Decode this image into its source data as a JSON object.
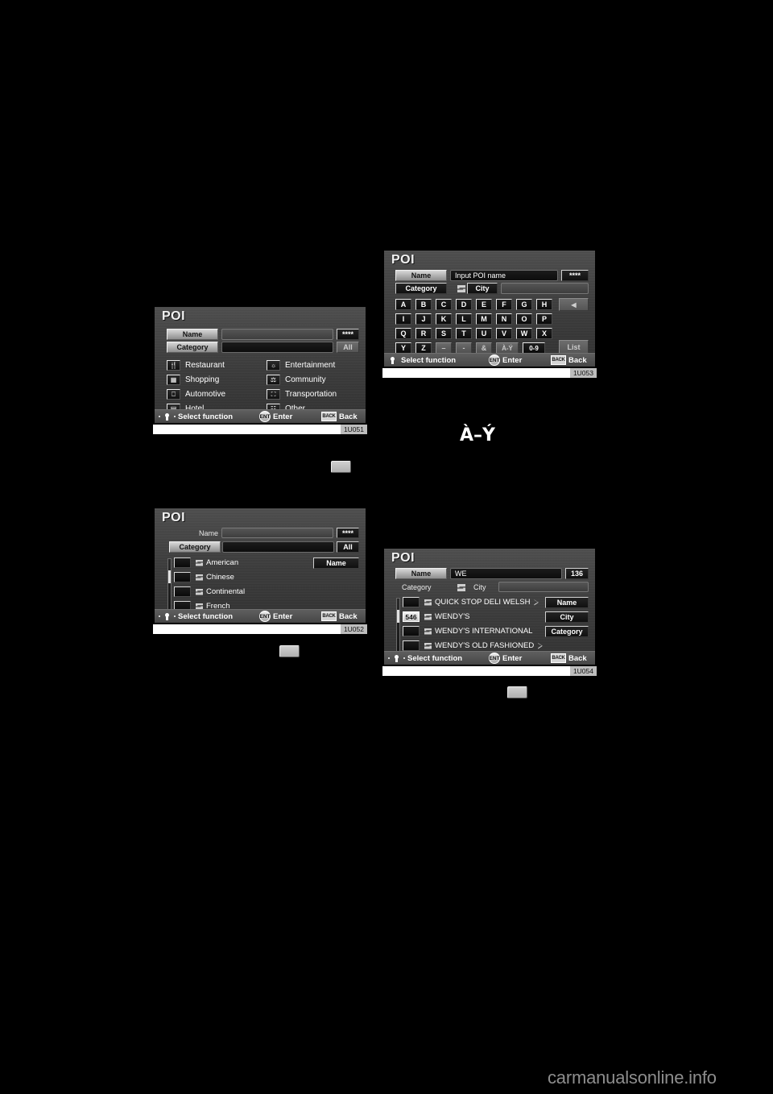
{
  "page": {
    "background": "#000000",
    "footer_text": "carmanualsonline.info"
  },
  "shots": [
    {
      "id": "poi-category-menu",
      "caption": "1U051",
      "title": "POI",
      "name_button": "Name",
      "name_value": "",
      "stars_button": "****",
      "category_button": "Category",
      "category_value": "",
      "all_button": "All",
      "categories": [
        {
          "label": "Restaurant",
          "icon": "restaurant-icon"
        },
        {
          "label": "Shopping",
          "icon": "shopping-icon"
        },
        {
          "label": "Automotive",
          "icon": "automotive-icon"
        },
        {
          "label": "Hotel",
          "icon": "hotel-icon"
        },
        {
          "label": "Entertainment",
          "icon": "entertainment-icon"
        },
        {
          "label": "Community",
          "icon": "community-icon"
        },
        {
          "label": "Transportation",
          "icon": "transportation-icon"
        },
        {
          "label": "Other",
          "icon": "other-icon"
        }
      ],
      "hints": {
        "select": "Select function",
        "enter": "Enter",
        "enter_icon": "ENT",
        "back": "Back",
        "back_icon": "BACK"
      }
    },
    {
      "id": "poi-subcategory-list",
      "caption": "1U052",
      "title": "POI",
      "name_label": "Name",
      "name_value": "",
      "stars_button": "****",
      "category_button": "Category",
      "category_value": "",
      "all_button": "All",
      "side_button": "Name",
      "items": [
        {
          "label": "American",
          "box": "",
          "icon": "list-icon"
        },
        {
          "label": "Chinese",
          "box": "",
          "icon": "list-icon"
        },
        {
          "label": "Continental",
          "box": "",
          "icon": "list-icon"
        },
        {
          "label": "French",
          "box": "",
          "icon": "list-icon"
        }
      ],
      "hints": {
        "select": "Select function",
        "enter": "Enter",
        "enter_icon": "ENT",
        "back": "Back",
        "back_icon": "BACK"
      }
    },
    {
      "id": "poi-name-keyboard",
      "caption": "1U053",
      "title": "POI",
      "name_button": "Name",
      "name_value": "Input POI name",
      "stars_button": "****",
      "category_button": "Category",
      "swap_icon": "swap-icon",
      "city_button": "City",
      "city_value": "",
      "keys_row1": [
        "A",
        "B",
        "C",
        "D",
        "E",
        "F",
        "G",
        "H"
      ],
      "keys_row2": [
        "I",
        "J",
        "K",
        "L",
        "M",
        "N",
        "O",
        "P"
      ],
      "keys_row3": [
        "Q",
        "R",
        "S",
        "T",
        "U",
        "V",
        "W",
        "X"
      ],
      "keys_row4": [
        {
          "label": "Y",
          "state": "on"
        },
        {
          "label": "Z",
          "state": "on"
        },
        {
          "label": "–",
          "state": "off"
        },
        {
          "label": "-",
          "state": "off"
        },
        {
          "label": "&",
          "state": "off"
        },
        {
          "label": "À-Ý",
          "state": "off"
        },
        {
          "label": "0-9",
          "state": "on"
        }
      ],
      "backspace_label": "◀",
      "list_button": "List",
      "hints": {
        "select": "Select function",
        "enter": "Enter",
        "enter_icon": "ENT",
        "back": "Back",
        "back_icon": "BACK"
      }
    },
    {
      "id": "poi-results-list",
      "caption": "1U054",
      "title": "POI",
      "name_button": "Name",
      "name_value": "WE",
      "count_button": "136",
      "category_label": "Category",
      "swap_icon": "swap-icon",
      "city_label": "City",
      "city_value": "",
      "side_buttons": [
        "Name",
        "City",
        "Category"
      ],
      "items": [
        {
          "label": "QUICK STOP DELI WELSH",
          "box": "",
          "selected": false,
          "arrow": true
        },
        {
          "label": "WENDY'S",
          "box": "546",
          "selected": true,
          "arrow": false
        },
        {
          "label": "WENDY'S INTERNATIONAL",
          "box": "",
          "selected": false,
          "arrow": false
        },
        {
          "label": "WENDY'S OLD FASHIONED",
          "box": "",
          "selected": false,
          "arrow": true
        }
      ],
      "hints": {
        "select": "Select function",
        "enter": "Enter",
        "enter_icon": "ENT",
        "back": "Back",
        "back_icon": "BACK"
      }
    }
  ],
  "standalone_glyph": {
    "label": "À–Ý",
    "name": "accented-letters-key-glyph"
  },
  "mini_buttons": [
    {
      "name": "button-graphic-1"
    },
    {
      "name": "button-graphic-2"
    },
    {
      "name": "button-graphic-3"
    }
  ]
}
